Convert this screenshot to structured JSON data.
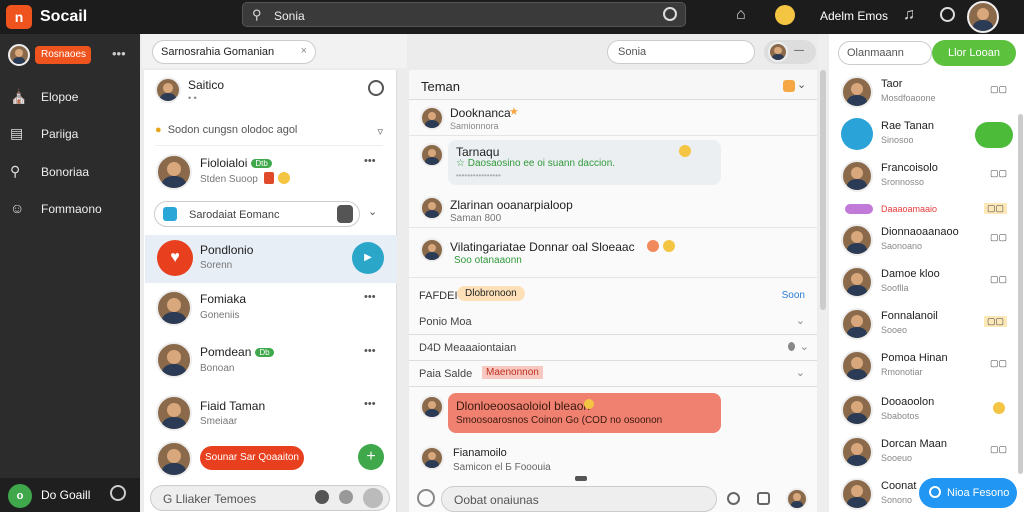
{
  "topbar": {
    "app_title": "Socail",
    "search_text": "Sonia",
    "user_name": "Adelm Emos"
  },
  "sidebar": {
    "notif_label": "Rosnaoes",
    "items": [
      {
        "label": "Elopoe",
        "icon": "home-icon"
      },
      {
        "label": "Pariiga",
        "icon": "list-icon"
      },
      {
        "label": "Bonoriaa",
        "icon": "search-icon"
      },
      {
        "label": "Fommaono",
        "icon": "smile-icon"
      }
    ],
    "bottom_label": "Do Goaill"
  },
  "contacts": {
    "search_placeholder": "Sarnosrahia Gomanian",
    "header_name": "Saitico",
    "header_sub": "• •",
    "pinned_note": "Sodon cungsn olodoc agol",
    "items": [
      {
        "name": "Fioloialoi",
        "sub": "Stden Suoop",
        "badge": "Dtb"
      },
      {
        "name": "Pondlonio",
        "sub": "Sorenn"
      },
      {
        "name": "Fomiaka",
        "sub": "Goneniis"
      },
      {
        "name": "Pomdean",
        "sub": "Bonoan",
        "badge": "Db"
      },
      {
        "name": "Fiaid Taman",
        "sub": "Smeiaar"
      }
    ],
    "subfield": "Sarodaiat Eomanc",
    "action_pill": "Sounar Sar Qoaaiton",
    "bottom_input": "G Lliaker Temoes"
  },
  "chat": {
    "title": "Teman",
    "messages": [
      {
        "name": "Dooknanca",
        "sub": "Samionnora"
      },
      {
        "name": "Tarnaqu",
        "text": "☆ Daosaosino ee oi suann daccion.",
        "meta": "••••••••••••••••"
      },
      {
        "name": "Zlarinan ooanarpialoop",
        "sub": "Saman 800"
      },
      {
        "name": "Vilatingariatae Donnar oal Sloeaac",
        "text": "Soo otanaaonn"
      },
      {
        "name": "Fianamoilo",
        "sub": "Samicon el Б Fooouia"
      }
    ],
    "section_label": "FAFDEI",
    "section_tag": "Dlobronoon",
    "section_link": "Soon",
    "rows": [
      "Ponio Moa",
      "D4D Meaaaiontaian",
      "Paia Salde"
    ],
    "row_tag": "Maenonnon",
    "alert_line1": "Dlonloeoosaoloiol bleaon",
    "alert_line2": "Smoosoarosnos Coinon Go (COD no osoonon",
    "composer_placeholder": "Oobat onaiunas"
  },
  "right": {
    "search_placeholder": "Olanmaann",
    "action_button": "Llor Looan",
    "items": [
      {
        "name": "Taor",
        "sub": "Mosdfoaoone",
        "meta": "▢▢"
      },
      {
        "name": "Rae Tanan",
        "sub": "Sinosoo",
        "meta": ""
      },
      {
        "name": "Francoisolo",
        "sub": "Sronnosso",
        "meta": "▢▢"
      },
      {
        "name": "Daaaoamaaio",
        "sub": "",
        "meta": "▢▢"
      },
      {
        "name": "Dionnaoaanaoo",
        "sub": "Saonoano",
        "meta": "▢▢"
      },
      {
        "name": "Damoe kloo",
        "sub": "Sooflla",
        "meta": "▢▢"
      },
      {
        "name": "Fonnalanoil",
        "sub": "Sooeo",
        "meta": "▢▢"
      },
      {
        "name": "Pomoa Hinan",
        "sub": "Rmonotiar",
        "meta": "▢▢"
      },
      {
        "name": "Dooaoolon",
        "sub": "Sbabotos",
        "meta": ""
      },
      {
        "name": "Dorcan Maan",
        "sub": "Sooeuo",
        "meta": "▢▢"
      },
      {
        "name": "Coonat",
        "sub": "Sonono",
        "meta": ""
      }
    ],
    "fab_label": "Nioa Fesono"
  },
  "colors": {
    "accent": "#f0541e",
    "green": "#3fa84b",
    "blue": "#2196f3",
    "alert": "#f08070"
  }
}
